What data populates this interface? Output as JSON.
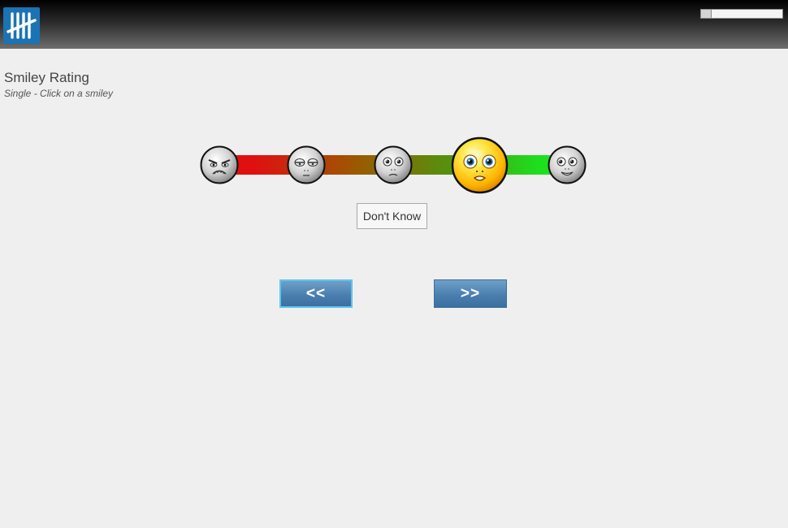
{
  "header": {
    "logo_icon": "tally-marks-icon",
    "progress_value": 0.12
  },
  "question": {
    "title": "Smiley Rating",
    "subtitle": "Single - Click on a smiley"
  },
  "scale": {
    "options": [
      {
        "icon": "angry-smiley-icon",
        "selected": false
      },
      {
        "icon": "sleepy-smiley-icon",
        "selected": false
      },
      {
        "icon": "neutral-smiley-icon",
        "selected": false
      },
      {
        "icon": "happy-smiley-icon",
        "selected": true
      },
      {
        "icon": "grinning-smiley-icon",
        "selected": false
      }
    ],
    "gradient_colors": [
      "#e01010",
      "#9a5a00",
      "#4a9a10",
      "#1de01d"
    ],
    "dont_know_label": "Don't Know"
  },
  "navigation": {
    "back_label": "<<",
    "next_label": ">>"
  }
}
